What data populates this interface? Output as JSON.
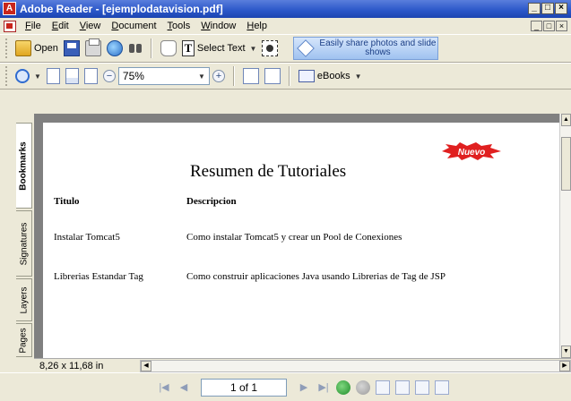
{
  "window": {
    "title": "Adobe Reader - [ejemplodatavision.pdf]",
    "controls": [
      "_",
      "□",
      "×"
    ],
    "mdi_controls": [
      "_",
      "□",
      "×"
    ]
  },
  "menu": [
    "File",
    "Edit",
    "View",
    "Document",
    "Tools",
    "Window",
    "Help"
  ],
  "toolbar1": {
    "open_label": "Open",
    "select_text_label": "Select Text",
    "promo_text": "Easily share photos and slide shows"
  },
  "toolbar2": {
    "zoom_value": "75%",
    "ebooks_label": "eBooks"
  },
  "nav_tabs": [
    "Bookmarks",
    "Signatures",
    "Layers",
    "Pages"
  ],
  "document": {
    "heading": "Resumen de Tutoriales",
    "badge": "Nuevo",
    "columns": [
      "Titulo",
      "Descripcion"
    ],
    "rows": [
      {
        "title": "Instalar Tomcat5",
        "description": "Como instalar Tomcat5 y crear un Pool de Conexiones"
      },
      {
        "title": "Librerias Estandar Tag",
        "description": "Como construir aplicaciones Java usando Librerias de Tag de JSP"
      }
    ]
  },
  "status": {
    "page_size": "8,26 x 11,68 in",
    "page_indicator": "1 of 1"
  },
  "colors": {
    "titlebar": "#2a56c8",
    "chrome": "#ece9d8",
    "badge": "#e02020"
  }
}
